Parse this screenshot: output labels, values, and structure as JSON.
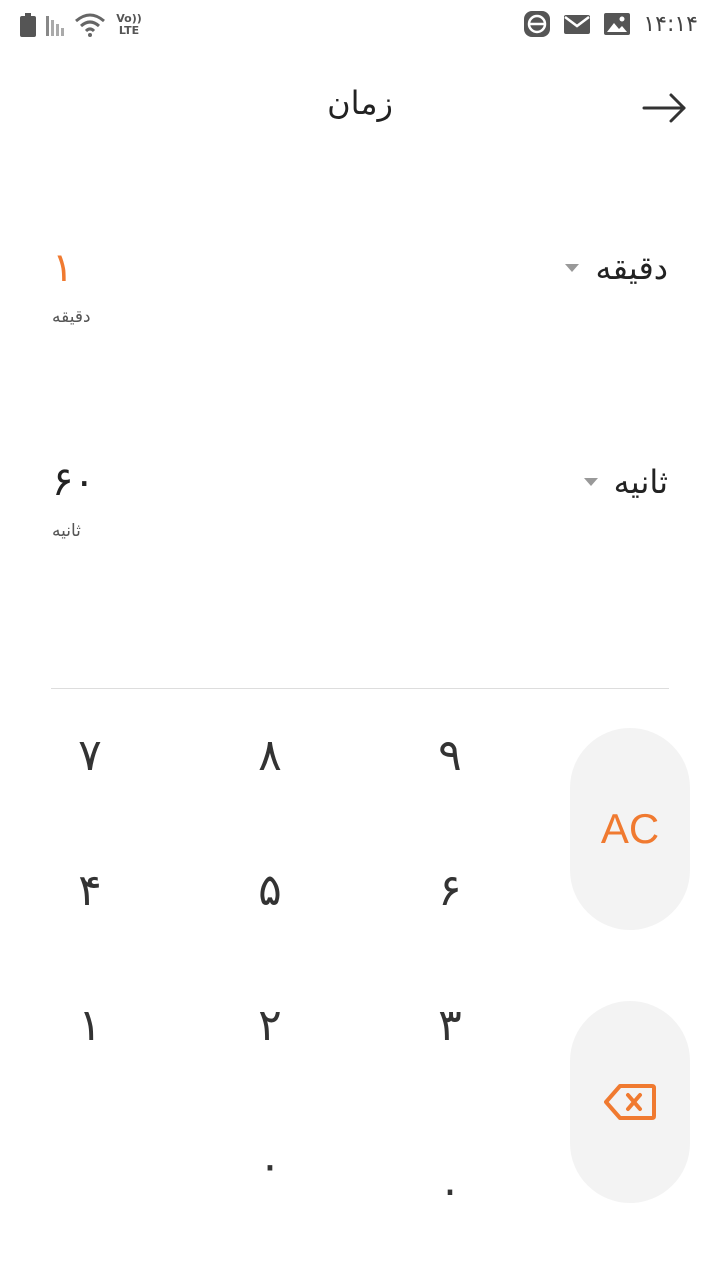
{
  "status_bar": {
    "clock": "۱۴:۱۴",
    "network_label": "Vo)) LTE",
    "icons": [
      "battery-icon",
      "signal-icon",
      "wifi-icon",
      "volte-icon",
      "app-e-icon",
      "mail-icon",
      "image-icon"
    ]
  },
  "header": {
    "title": "زمان",
    "back_icon": "arrow-right-icon"
  },
  "fields": {
    "minute": {
      "value": "۱",
      "unit": "دقیقه",
      "sub": "دقیقه"
    },
    "second": {
      "value": "۶۰",
      "unit": "ثانیه",
      "sub": "ثانیه"
    }
  },
  "keypad": {
    "k7": "۷",
    "k8": "۸",
    "k9": "۹",
    "k4": "۴",
    "k5": "۵",
    "k6": "۶",
    "k1": "۱",
    "k2": "۲",
    "k3": "۳",
    "k0": "۰",
    "dot": ".",
    "clear_label": "AC",
    "backspace_icon": "backspace-icon"
  },
  "colors": {
    "accent": "#f07a30",
    "button_bg": "#f3f3f3",
    "divider": "#dddddd"
  }
}
